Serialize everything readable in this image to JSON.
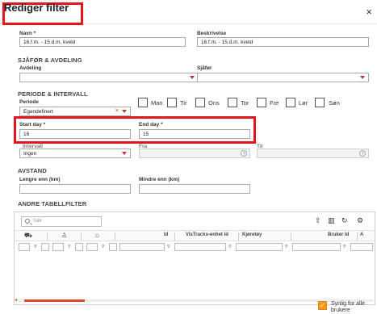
{
  "dialog": {
    "title": "Rediger filter",
    "close": "×"
  },
  "fields": {
    "navn": {
      "label": "Navn *",
      "value": "16.f.m. - 15.d.m. kveld"
    },
    "beskrivelse": {
      "label": "Beskrivelse",
      "value": "16.f.m. - 15.d.m. kveld"
    },
    "avdeling": {
      "label": "Avdeling",
      "value": ""
    },
    "sjafor": {
      "label": "Sjåfør",
      "value": ""
    },
    "periode": {
      "label": "Periode",
      "value": "Egendefinert"
    },
    "start_day": {
      "label": "Start day *",
      "value": "16"
    },
    "end_day": {
      "label": "End day *",
      "value": "15"
    },
    "intervall": {
      "label": "Intervall",
      "value": "Ingen"
    },
    "fra": {
      "label": "Fra",
      "value": ""
    },
    "til": {
      "label": "Til",
      "value": ""
    },
    "lengre_enn": {
      "label": "Lengre enn (km)",
      "value": ""
    },
    "mindre_enn": {
      "label": "Mindre enn (km)",
      "value": ""
    }
  },
  "sections": {
    "sjafor_avdeling": "SJÅFØR & AVDELING",
    "periode_intervall": "PERIODE & INTERVALL",
    "avstand": "AVSTAND",
    "andre_tabellfilter": "ANDRE TABELLFILTER"
  },
  "days": [
    "Man",
    "Tir",
    "Ons",
    "Tor",
    "Fre",
    "Lør",
    "Søn"
  ],
  "grid": {
    "search_placeholder": "Søk",
    "columns": [
      "Id",
      "VisTracks-enhet Id",
      "Kjøretøy",
      "Bruker Id"
    ],
    "filter_symbol": "▿",
    "col_sep": "|"
  },
  "visible_for_all": {
    "label": "Synlig for alle brukere",
    "checked": true
  },
  "icons": {
    "close": "close-icon",
    "search": "search-icon",
    "car": "car-icon",
    "person": "person-icon",
    "home": "home-icon",
    "export": "export-icon",
    "columns": "columns-icon",
    "refresh": "refresh-icon",
    "settings": "settings-icon",
    "dropdown": "chevron-down-icon",
    "clear": "clear-icon",
    "clock": "clock-icon"
  },
  "colors": {
    "highlight": "#e8141b",
    "accent": "#c0392b",
    "checkbox": "#f39c12"
  }
}
